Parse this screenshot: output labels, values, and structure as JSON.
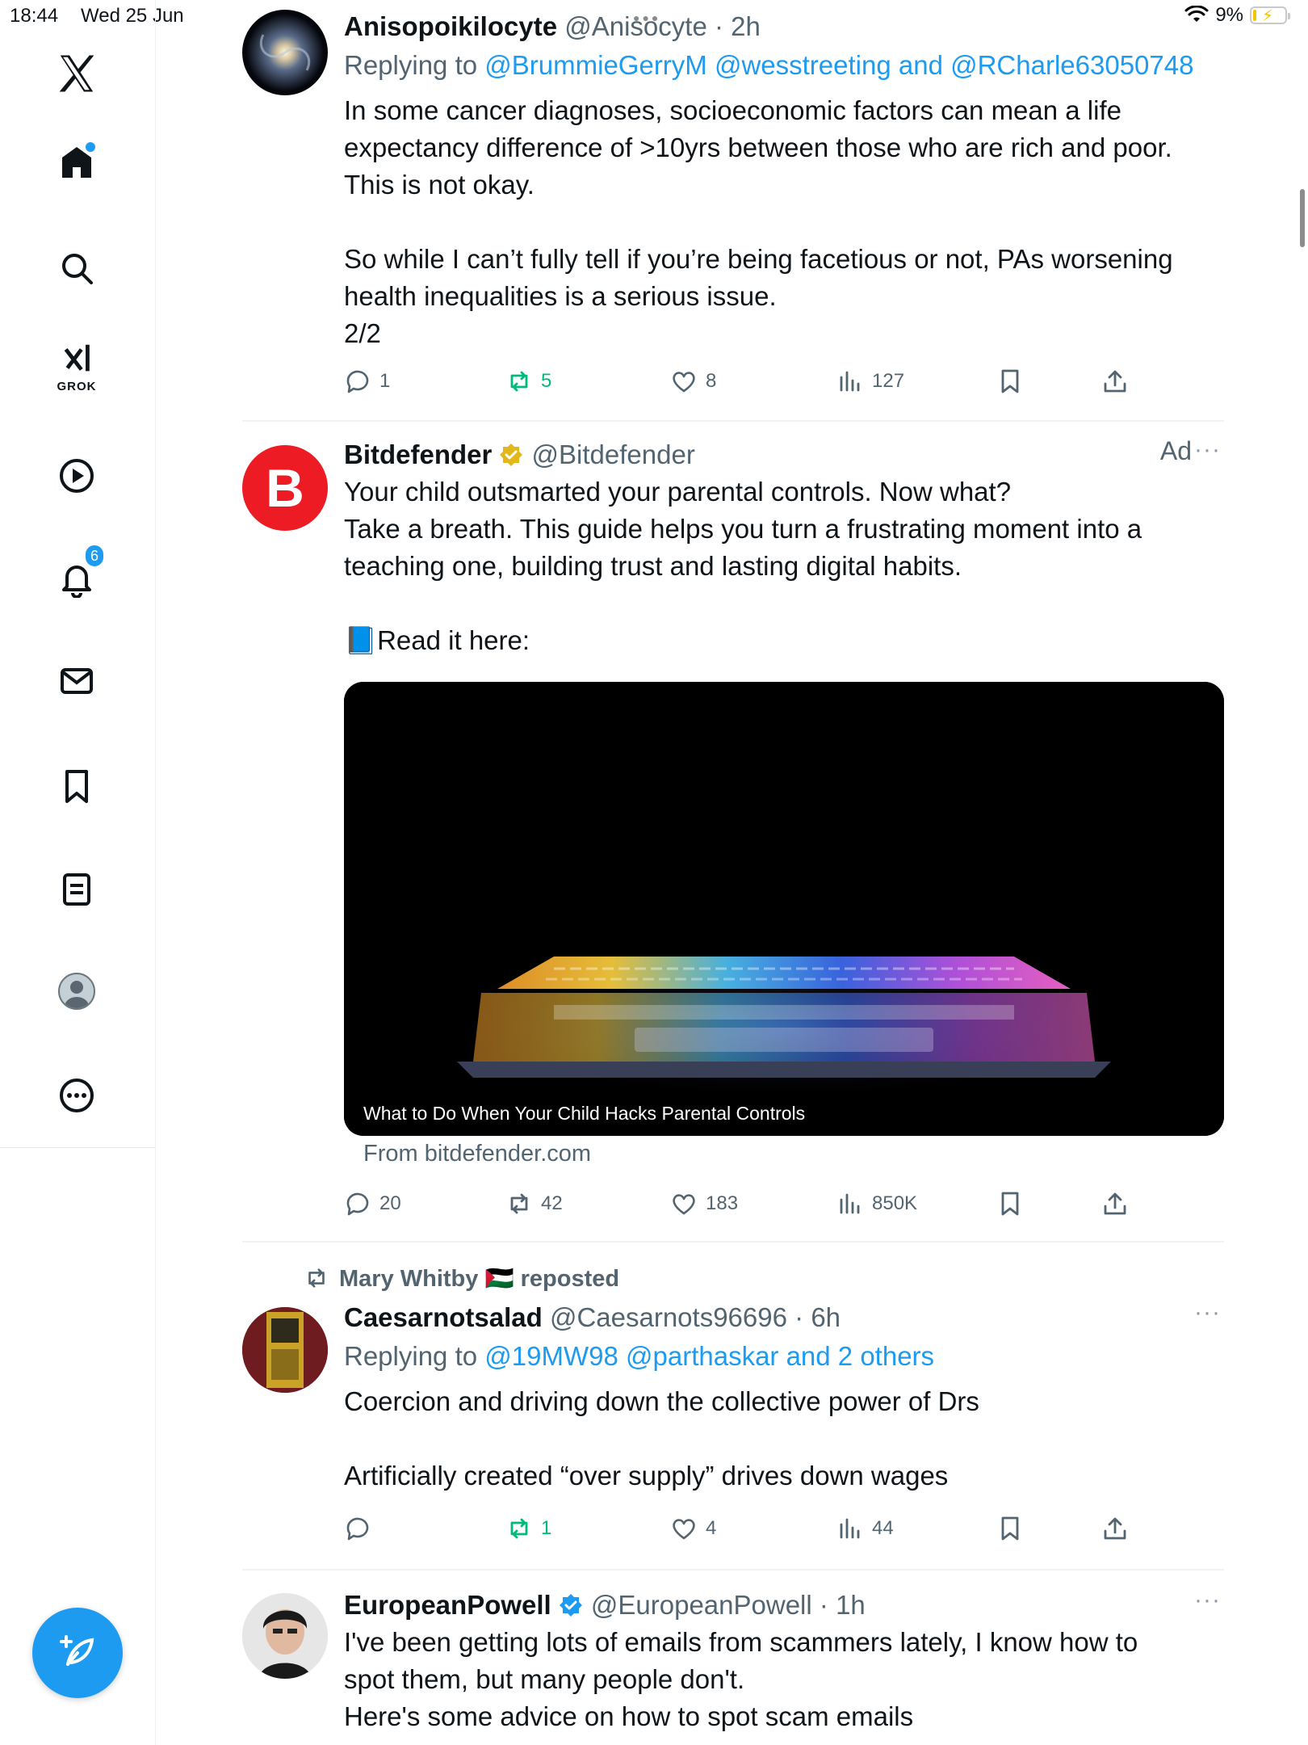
{
  "status": {
    "time": "18:44",
    "date": "Wed 25 Jun",
    "battery": "9%",
    "battery_level": 0.09
  },
  "sidebar": {
    "grok_label": "GROK",
    "notification_count": "6",
    "items": [
      "x-logo-icon",
      "home-icon",
      "search-icon",
      "grok-icon",
      "video-icon",
      "notifications-icon",
      "messages-icon",
      "bookmarks-icon",
      "lists-icon",
      "profile-icon",
      "more-icon",
      "compose-icon"
    ]
  },
  "colors": {
    "accent": "#1d9bf0",
    "repost_green": "#00ba7c",
    "muted": "#536471",
    "verified_gold": "#e2b719",
    "bitdefender_red": "#ed1c24"
  },
  "posts": [
    {
      "name": "Anisopoikilocyte",
      "handle": "@Anisocyte",
      "time": "2h",
      "replying_prefix": "Replying to",
      "replying_to": "@BrummieGerryM @wesstreeting and @RCharle63050748",
      "text": [
        "In some cancer diagnoses, socioeconomic factors can mean a life",
        "expectancy difference of >10yrs between those who are rich and poor.",
        "This is not okay.",
        "",
        "So while I can’t fully tell if you’re being facetious or not, PAs worsening",
        "health inequalities is a serious issue.",
        "2/2"
      ],
      "replies": "1",
      "reposts": "5",
      "likes": "8",
      "views": "127"
    },
    {
      "name": "Bitdefender",
      "handle": "@Bitdefender",
      "ad_label": "Ad",
      "avatar_letter": "B",
      "text": [
        "Your child outsmarted your parental controls. Now what?",
        "Take a breath. This guide helps you turn a frustrating moment into a",
        "teaching one, building trust and lasting digital habits.",
        "",
        "📘Read it here:"
      ],
      "media_caption": "What to Do When Your Child Hacks Parental Controls",
      "source": "From bitdefender.com",
      "replies": "20",
      "reposts": "42",
      "likes": "183",
      "views": "850K"
    },
    {
      "reposted_by": "Mary Whitby 🇵🇸 reposted",
      "name": "Caesarnotsalad",
      "handle": "@Caesarnots96696",
      "time": "6h",
      "replying_prefix": "Replying to",
      "replying_to": "@19MW98 @parthaskar and 2 others",
      "text": [
        "Coercion and driving down the collective power of Drs",
        "",
        "Artificially created “over supply” drives down wages"
      ],
      "replies": "",
      "reposts": "1",
      "likes": "4",
      "views": "44"
    },
    {
      "name": "EuropeanPowell",
      "handle": "@EuropeanPowell",
      "time": "1h",
      "text": [
        "I've been getting lots of emails from scammers lately, I know how to",
        "spot them, but many people don't.",
        "Here's some advice on how to spot scam emails"
      ]
    }
  ]
}
